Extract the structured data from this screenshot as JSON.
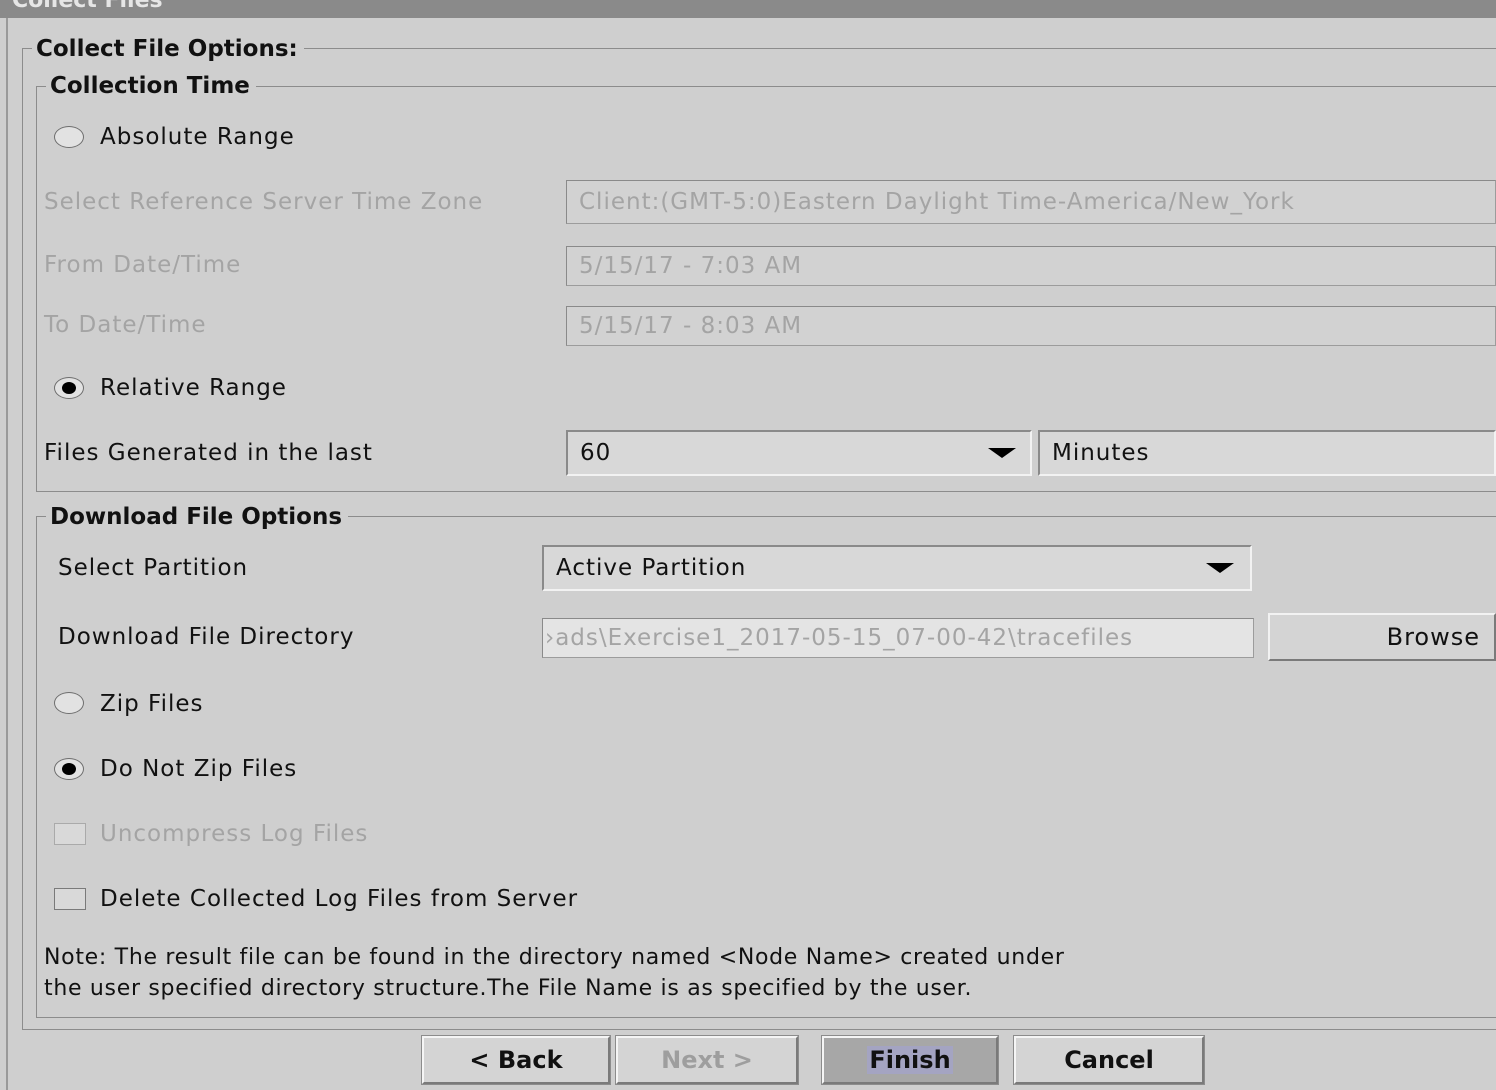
{
  "window": {
    "title": "Collect Files"
  },
  "collect_options": {
    "title": "Collect File Options:"
  },
  "collection_time": {
    "title": "Collection Time",
    "absolute_range": {
      "label": "Absolute Range",
      "selected": false
    },
    "time_zone": {
      "label": "Select Reference Server Time Zone",
      "value": "Client:(GMT-5:0)Eastern Daylight Time-America/New_York"
    },
    "from": {
      "label": "From Date/Time",
      "value": "5/15/17 - 7:03 AM"
    },
    "to": {
      "label": "To Date/Time",
      "value": "5/15/17 - 8:03 AM"
    },
    "relative_range": {
      "label": "Relative Range",
      "selected": true
    },
    "files_generated": {
      "label": "Files Generated in the last",
      "value": "60",
      "unit": "Minutes"
    }
  },
  "download_options": {
    "title": "Download File Options",
    "partition": {
      "label": "Select Partition",
      "value": "Active Partition"
    },
    "directory": {
      "label": "Download File Directory",
      "value": "›ads\\Exercise1_2017-05-15_07-00-42\\tracefiles",
      "browse_label": "Browse"
    },
    "zip_files": {
      "label": "Zip Files",
      "selected": false
    },
    "do_not_zip": {
      "label": "Do Not Zip Files",
      "selected": true
    },
    "uncompress": {
      "label": "Uncompress Log Files",
      "checked": false,
      "enabled": false
    },
    "delete_collected": {
      "label": "Delete Collected Log Files from Server",
      "checked": false
    },
    "note_line1": "Note: The result file can be found in the directory named <Node Name> created under",
    "note_line2": "the user specified directory structure.The File Name is as specified by the user."
  },
  "buttons": {
    "back": "< Back",
    "next": "Next >",
    "finish": "Finish",
    "cancel": "Cancel"
  }
}
